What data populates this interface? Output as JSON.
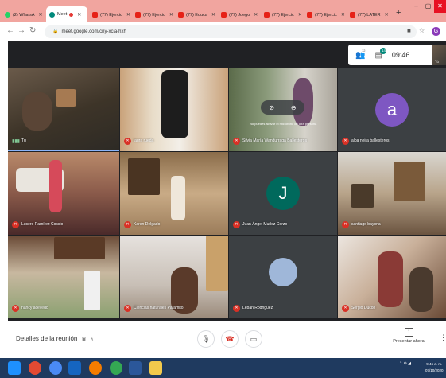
{
  "tabs": [
    {
      "label": "(2) WhatsA",
      "icon": "whatsapp-icon"
    },
    {
      "label": "Meet",
      "icon": "meet-icon",
      "active": true
    },
    {
      "label": "(77) Ejercic",
      "icon": "youtube-icon"
    },
    {
      "label": "(77) Ejercic",
      "icon": "youtube-icon"
    },
    {
      "label": "(77) Educa",
      "icon": "youtube-icon"
    },
    {
      "label": "(77) Juego",
      "icon": "youtube-icon"
    },
    {
      "label": "(77) Ejercic",
      "icon": "youtube-icon"
    },
    {
      "label": "(77) Ejercic",
      "icon": "youtube-icon"
    },
    {
      "label": "(77) LATER",
      "icon": "youtube-icon"
    }
  ],
  "address": {
    "url": "meet.google.com/cny-xcia-hxh"
  },
  "profile": {
    "initial": "G"
  },
  "topbar": {
    "participants_count": "12",
    "chat_badge": "14",
    "time": "09:46",
    "self_label": "Tú"
  },
  "tiles": [
    {
      "name": "Tú",
      "speaking": true
    },
    {
      "name": "laura rueda"
    },
    {
      "name": "Silvia María Wandurraga Ballesteros",
      "tooltip": "No puedes activar el micrófono de otra persona"
    },
    {
      "name": "alba neira ballesteros",
      "avatar_letter": "a",
      "avatar_color": "#7e57c2"
    },
    {
      "name": "Lucero Ramírez Cossio"
    },
    {
      "name": "Karen Delgado"
    },
    {
      "name": "Juan Ángel Muñoz Corzo",
      "avatar_letter": "J",
      "avatar_color": "#00695c"
    },
    {
      "name": "santiago bayona"
    },
    {
      "name": "nancy acevedo"
    },
    {
      "name": "Ciencias naturales Paramito"
    },
    {
      "name": "Leban Rodriguez"
    },
    {
      "name": "Sergio Ducón"
    }
  ],
  "bottom": {
    "details": "Detalles de la reunión",
    "present": "Presentar ahora"
  },
  "taskbar": {
    "time": "9:46 a. m.",
    "date": "07/10/2020"
  }
}
